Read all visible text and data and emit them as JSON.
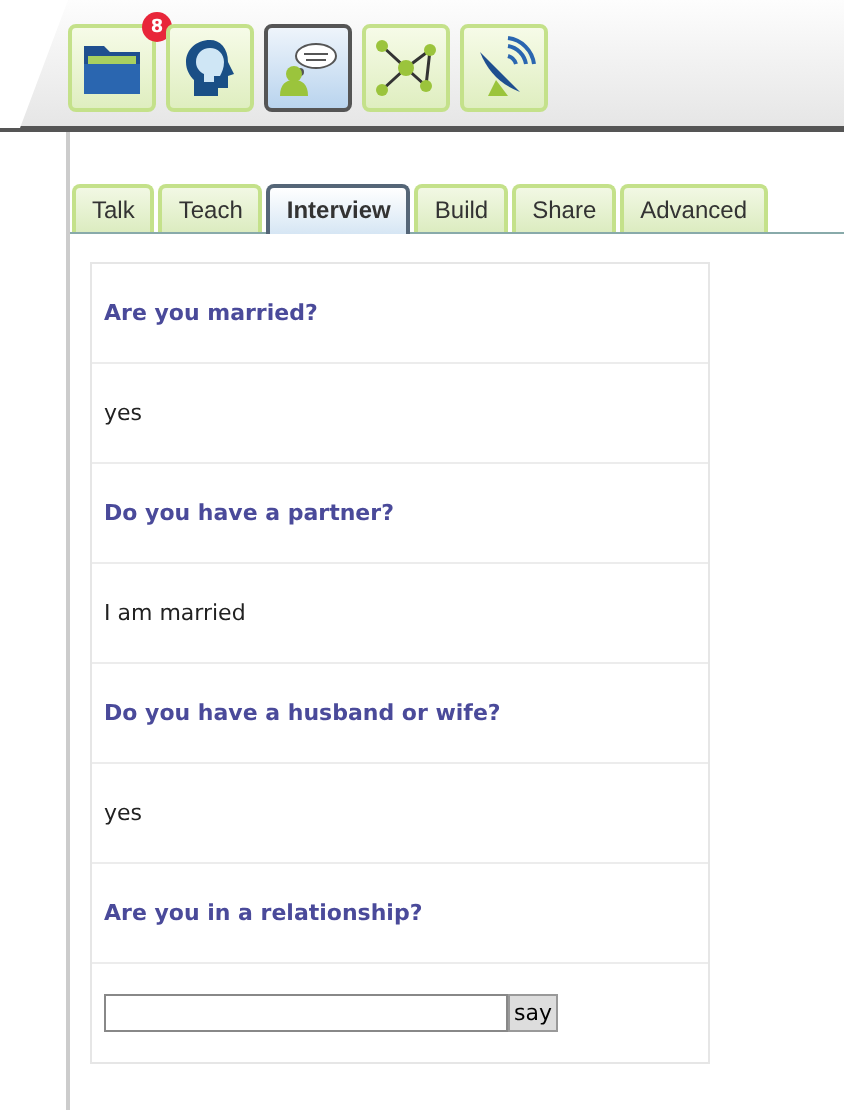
{
  "toolbar": {
    "buttons": [
      {
        "kind": "folder",
        "selected": false,
        "badge": "8"
      },
      {
        "kind": "head",
        "selected": false
      },
      {
        "kind": "chat",
        "selected": true
      },
      {
        "kind": "network",
        "selected": false
      },
      {
        "kind": "satellite",
        "selected": false
      }
    ]
  },
  "tabs": [
    {
      "label": "Talk",
      "selected": false
    },
    {
      "label": "Teach",
      "selected": false
    },
    {
      "label": "Interview",
      "selected": true
    },
    {
      "label": "Build",
      "selected": false
    },
    {
      "label": "Share",
      "selected": false
    },
    {
      "label": "Advanced",
      "selected": false
    }
  ],
  "rows": [
    {
      "kind": "question",
      "text": "Are you married?"
    },
    {
      "kind": "answer",
      "text": "yes"
    },
    {
      "kind": "question",
      "text": "Do you have a partner?"
    },
    {
      "kind": "answer",
      "text": "I am married"
    },
    {
      "kind": "question",
      "text": "Do you have a husband or wife?"
    },
    {
      "kind": "answer",
      "text": "yes"
    },
    {
      "kind": "question",
      "text": "Are you in a relationship?"
    },
    {
      "kind": "input",
      "button": "say"
    }
  ]
}
